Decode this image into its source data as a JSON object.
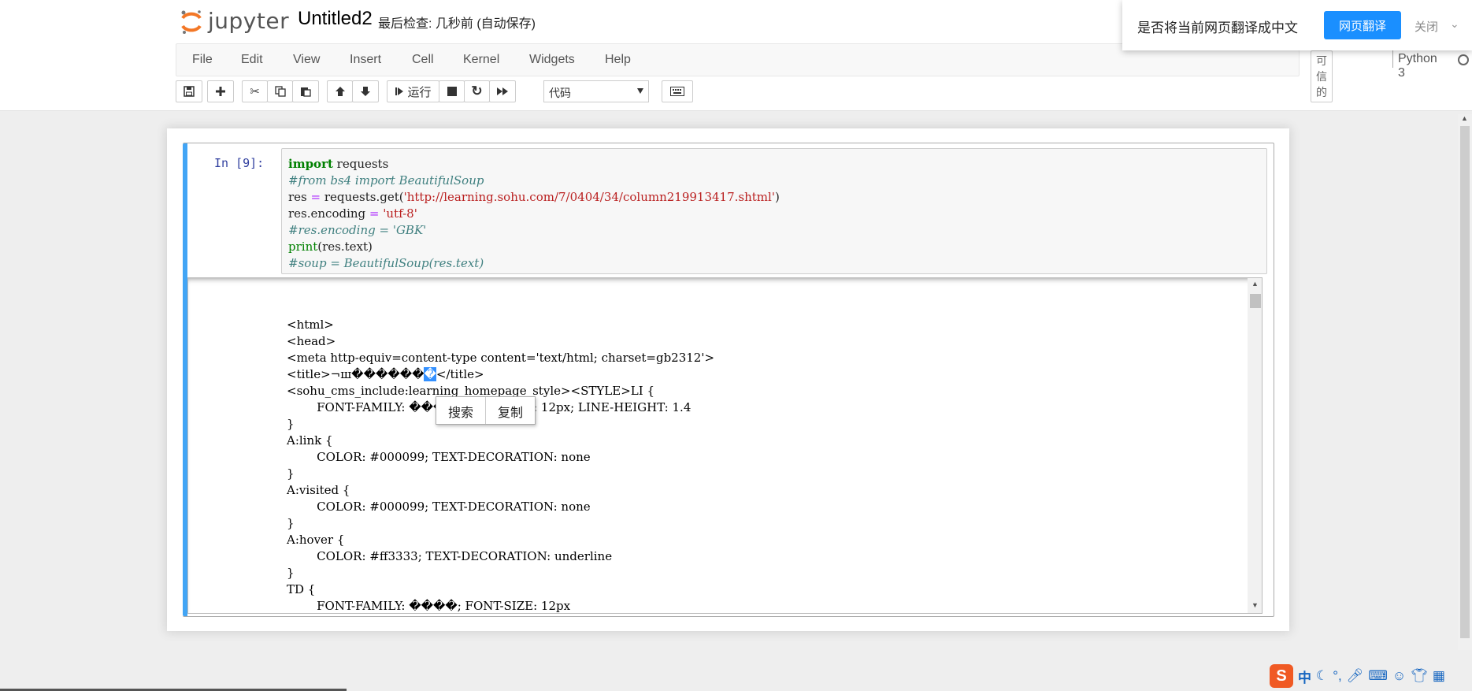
{
  "header": {
    "logo_text": "jupyter",
    "notebook_title": "Untitled2",
    "checkpoint": "最后检查: 几秒前  (自动保存)"
  },
  "menu": {
    "items": [
      "File",
      "Edit",
      "View",
      "Insert",
      "Cell",
      "Kernel",
      "Widgets",
      "Help"
    ],
    "trusted": "可信的",
    "kernel_name": "Python 3"
  },
  "toolbar": {
    "run_label": "运行",
    "cell_type": "代码",
    "icons": [
      "save-icon",
      "plus-icon",
      "scissors-icon",
      "copy-icon",
      "paste-icon",
      "arrow-up-icon",
      "arrow-down-icon",
      "step-forward-icon",
      "stop-icon",
      "refresh-icon",
      "fast-forward-icon",
      "keyboard-icon"
    ]
  },
  "translate_popup": {
    "message": "是否将当前网页翻译成中文",
    "translate_button": "网页翻译",
    "close_label": "关闭"
  },
  "cell": {
    "prompt": "In  [9]:",
    "code": {
      "l1_kw": "import",
      "l1_rest": " requests",
      "l2": "#from bs4 import BeautifulSoup",
      "l3_a": "res ",
      "l3_op": "=",
      "l3_b": " requests.get(",
      "l3_str": "'http://learning.sohu.com/7/0404/34/column219913417.shtml'",
      "l3_c": ")",
      "l4_a": "res.encoding ",
      "l4_op": "=",
      "l4_str": " 'utf-8'",
      "l5": "#res.encoding = 'GBK'",
      "l6_bi": "print",
      "l6_rest": "(res.text)",
      "l7": "#soup = BeautifulSoup(res.text)"
    },
    "output": {
      "lines": [
        "<html>",
        "<head>",
        "<meta http-equiv=content-type content='text/html; charset=gb2312'>",
        "<sohu_cms_include:learning_homepage_style><STYLE>LI {",
        "        FONT-FAMILY: ����; FONT-SIZE: 12px; LINE-HEIGHT: 1.4",
        "}",
        "A:link {",
        "        COLOR: #000099; TEXT-DECORATION: none",
        "}",
        "A:visited {",
        "        COLOR: #000099; TEXT-DECORATION: none",
        "}",
        "A:hover {",
        "        COLOR: #ff3333; TEXT-DECORATION: underline",
        "}",
        "TD {",
        "        FONT-FAMILY: ����; FONT-SIZE: 12px"
      ],
      "title_open": "<title>",
      "title_garbled": "¬ш������",
      "title_selected": "�",
      "title_close": "</title>"
    }
  },
  "context_menu": {
    "search": "搜索",
    "copy": "复制"
  },
  "ime": {
    "logo": "S",
    "mode": "中"
  }
}
